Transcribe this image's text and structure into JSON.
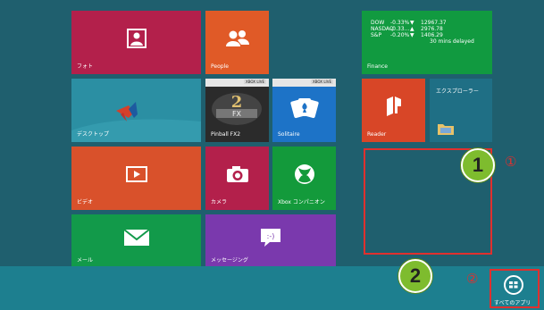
{
  "tiles": {
    "photo": {
      "label": "フォト"
    },
    "people": {
      "label": "People"
    },
    "desktop": {
      "label": "デスクトップ"
    },
    "pinball": {
      "label": "Pinball FX2",
      "badge": "XBOX LIVE"
    },
    "solitaire": {
      "label": "Solitaire",
      "badge": "XBOX LIVE"
    },
    "video": {
      "label": "ビデオ"
    },
    "camera": {
      "label": "カメラ"
    },
    "xbox": {
      "label": "Xbox コンパニオン"
    },
    "mail": {
      "label": "メール"
    },
    "messaging": {
      "label": "メッセージング"
    },
    "finance": {
      "label": "Finance",
      "rows": [
        {
          "name": "DOW",
          "change": "-0.33%",
          "arrow": "▼",
          "value": "12967.37"
        },
        {
          "name": "NASDAQ",
          "change": "-0.33...",
          "arrow": "▲",
          "value": "2976.78"
        },
        {
          "name": "S&P",
          "change": "-0.20%",
          "arrow": "▼",
          "value": "1406.29"
        }
      ],
      "delay": "30 mins delayed"
    },
    "reader": {
      "label": "Reader"
    },
    "explorer": {
      "label": "エクスプローラー"
    }
  },
  "appbar": {
    "all_apps_label": "すべてのアプリ"
  },
  "annotations": {
    "bubble1": "1",
    "bubble2": "2",
    "mark1": "①",
    "mark2": "②"
  },
  "colors": {
    "background": "#1f5f6e",
    "annotation_red": "#e0302e",
    "bubble_green": "#7ebc2e"
  }
}
